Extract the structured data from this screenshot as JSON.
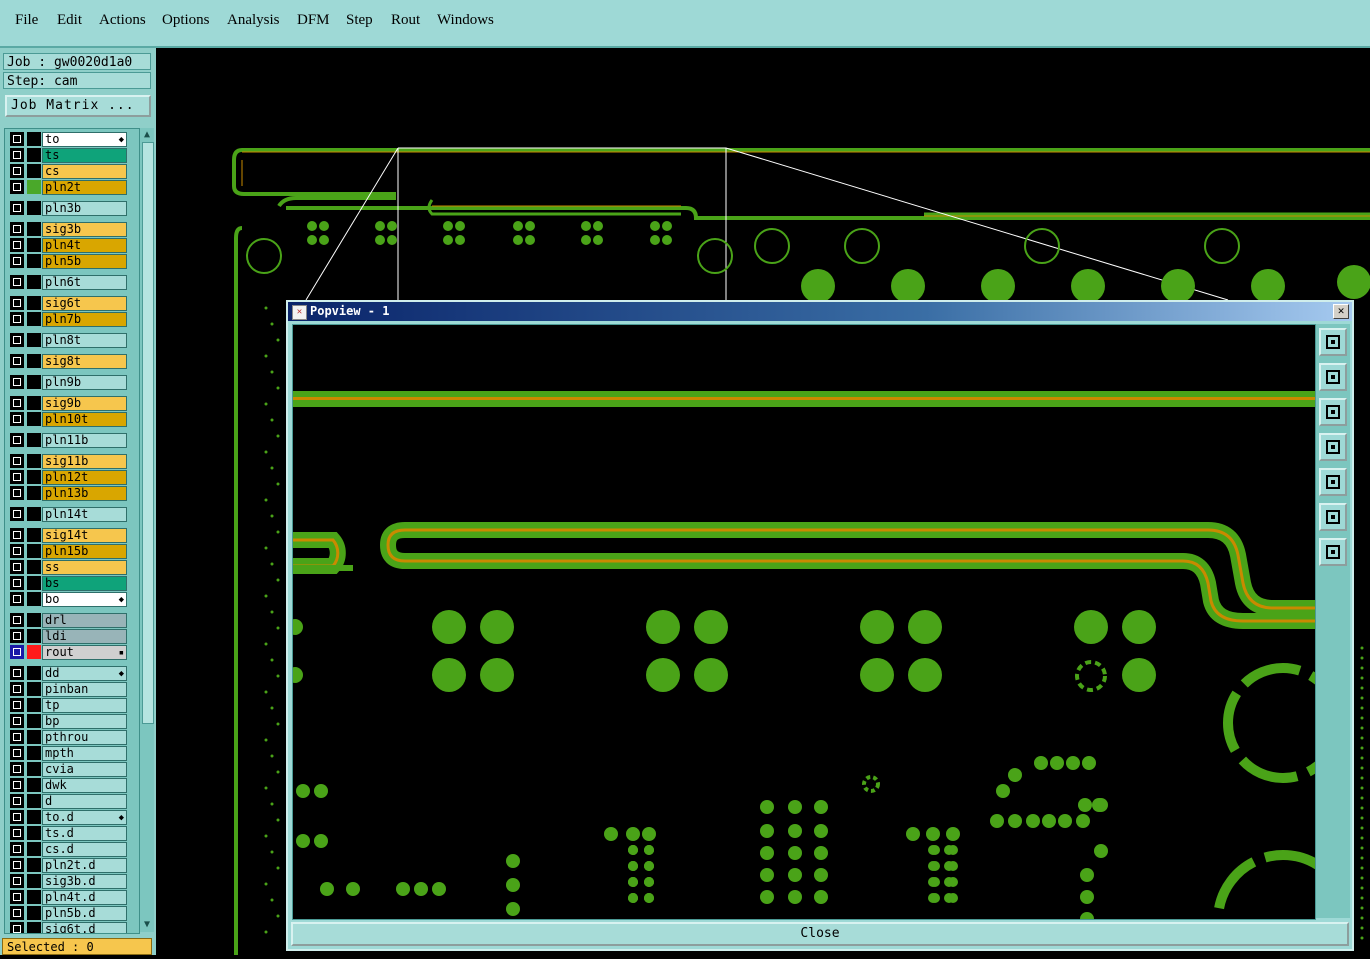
{
  "menu": [
    "File",
    "Edit",
    "Actions",
    "Options",
    "Analysis",
    "DFM",
    "Step",
    "Rout",
    "Windows"
  ],
  "job": {
    "job_label": "Job : gw0020d1a0",
    "step_label": "Step: cam",
    "matrix_button": "Job Matrix ..."
  },
  "layers": [
    {
      "name": "to",
      "color": "#ffffff",
      "flag": "◆"
    },
    {
      "name": "ts",
      "color": "#0fa37a"
    },
    {
      "name": "cs",
      "color": "#f6c64d"
    },
    {
      "name": "pln2t",
      "color": "#d9a600",
      "swatch": "#4aa82a"
    },
    {
      "name": "pln3b",
      "color": "#a7dcd8"
    },
    {
      "name": "sig3b",
      "color": "#f6c64d"
    },
    {
      "name": "pln4t",
      "color": "#d9a600"
    },
    {
      "name": "pln5b",
      "color": "#d9a600"
    },
    {
      "name": "pln6t",
      "color": "#a7dcd8"
    },
    {
      "name": "sig6t",
      "color": "#f6c64d"
    },
    {
      "name": "pln7b",
      "color": "#d9a600"
    },
    {
      "name": "pln8t",
      "color": "#a7dcd8"
    },
    {
      "name": "sig8t",
      "color": "#f6c64d"
    },
    {
      "name": "pln9b",
      "color": "#a7dcd8"
    },
    {
      "name": "sig9b",
      "color": "#f6c64d"
    },
    {
      "name": "pln10t",
      "color": "#d9a600"
    },
    {
      "name": "pln11b",
      "color": "#a7dcd8"
    },
    {
      "name": "sig11b",
      "color": "#f6c64d"
    },
    {
      "name": "pln12t",
      "color": "#d9a600"
    },
    {
      "name": "pln13b",
      "color": "#d9a600"
    },
    {
      "name": "pln14t",
      "color": "#a7dcd8"
    },
    {
      "name": "sig14t",
      "color": "#f6c64d"
    },
    {
      "name": "pln15b",
      "color": "#d9a600"
    },
    {
      "name": "ss",
      "color": "#f6c64d"
    },
    {
      "name": "bs",
      "color": "#0fa37a"
    },
    {
      "name": "bo",
      "color": "#ffffff",
      "flag": "◆"
    },
    {
      "name": "drl",
      "color": "#98b4b8"
    },
    {
      "name": "ldi",
      "color": "#98b4b8"
    },
    {
      "name": "rout",
      "color": "#d0d0d0",
      "swatch": "#ff1a1a",
      "checked": true,
      "flag": "▪"
    },
    {
      "name": "dd",
      "color": "#a7dcd8",
      "flag": "◆"
    },
    {
      "name": "pinban",
      "color": "#a7dcd8"
    },
    {
      "name": "tp",
      "color": "#a7dcd8"
    },
    {
      "name": "bp",
      "color": "#a7dcd8"
    },
    {
      "name": "pthrou",
      "color": "#a7dcd8"
    },
    {
      "name": "mpth",
      "color": "#a7dcd8"
    },
    {
      "name": "cvia",
      "color": "#a7dcd8"
    },
    {
      "name": "dwk",
      "color": "#a7dcd8"
    },
    {
      "name": "d",
      "color": "#a7dcd8"
    },
    {
      "name": "to.d",
      "color": "#a7dcd8",
      "flag": "◆"
    },
    {
      "name": "ts.d",
      "color": "#a7dcd8"
    },
    {
      "name": "cs.d",
      "color": "#a7dcd8"
    },
    {
      "name": "pln2t.d",
      "color": "#a7dcd8"
    },
    {
      "name": "sig3b.d",
      "color": "#a7dcd8"
    },
    {
      "name": "pln4t.d",
      "color": "#a7dcd8"
    },
    {
      "name": "pln5b.d",
      "color": "#a7dcd8"
    },
    {
      "name": "sig6t.d",
      "color": "#a7dcd8"
    }
  ],
  "status": {
    "selected": "Selected : 0"
  },
  "popup": {
    "title": "Popview - 1",
    "close_label": "Close",
    "close_x": "✕"
  },
  "tools": [
    "zoom-home-icon",
    "pan-up-icon",
    "pan-down-icon",
    "pan-left-icon",
    "pan-right-icon",
    "zoom-fit-icon",
    "zoom-center-icon"
  ],
  "colors": {
    "copper": "#4aa318",
    "trace_core": "#c98a00",
    "panel": "#9ed9d6"
  }
}
